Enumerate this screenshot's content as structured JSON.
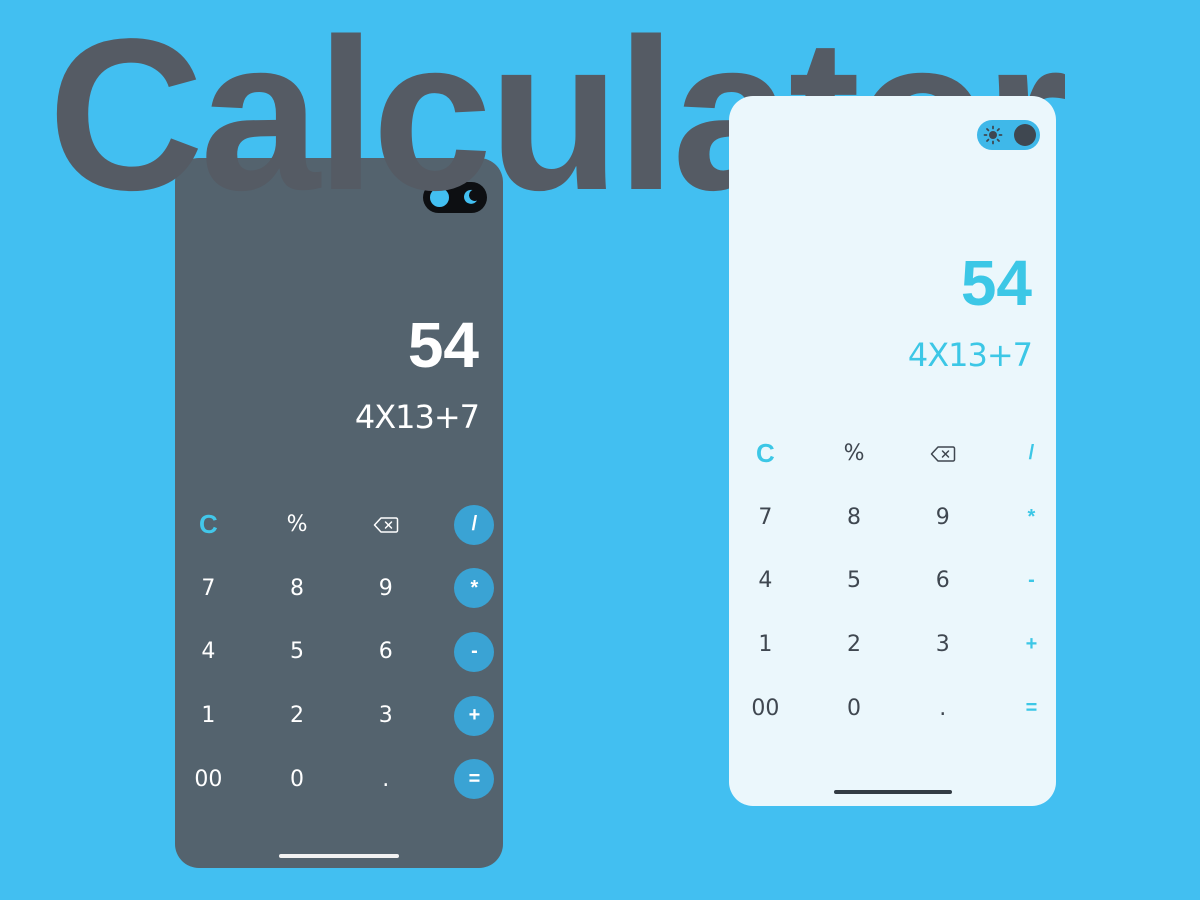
{
  "title": "Calculator",
  "dark_phone": {
    "result": "54",
    "expression": "4X13+7",
    "keys": [
      {
        "label": "C",
        "kind": "accent"
      },
      {
        "label": "%",
        "kind": "normal"
      },
      {
        "label": "",
        "kind": "backspace",
        "icon": "backspace-icon"
      },
      {
        "label": "/",
        "kind": "op"
      },
      {
        "label": "7",
        "kind": "normal"
      },
      {
        "label": "8",
        "kind": "normal"
      },
      {
        "label": "9",
        "kind": "normal"
      },
      {
        "label": "*",
        "kind": "op"
      },
      {
        "label": "4",
        "kind": "normal"
      },
      {
        "label": "5",
        "kind": "normal"
      },
      {
        "label": "6",
        "kind": "normal"
      },
      {
        "label": "-",
        "kind": "op"
      },
      {
        "label": "1",
        "kind": "normal"
      },
      {
        "label": "2",
        "kind": "normal"
      },
      {
        "label": "3",
        "kind": "normal"
      },
      {
        "label": "+",
        "kind": "op"
      },
      {
        "label": "00",
        "kind": "normal"
      },
      {
        "label": "0",
        "kind": "normal"
      },
      {
        "label": ".",
        "kind": "normal"
      },
      {
        "label": "=",
        "kind": "op"
      }
    ],
    "theme_toggle_icon": "moon-icon"
  },
  "light_phone": {
    "result": "54",
    "expression": "4X13+7",
    "keys": [
      {
        "label": "C",
        "kind": "accent"
      },
      {
        "label": "%",
        "kind": "normal"
      },
      {
        "label": "",
        "kind": "backspace",
        "icon": "backspace-icon"
      },
      {
        "label": "/",
        "kind": "op"
      },
      {
        "label": "7",
        "kind": "normal"
      },
      {
        "label": "8",
        "kind": "normal"
      },
      {
        "label": "9",
        "kind": "normal"
      },
      {
        "label": "*",
        "kind": "op"
      },
      {
        "label": "4",
        "kind": "normal"
      },
      {
        "label": "5",
        "kind": "normal"
      },
      {
        "label": "6",
        "kind": "normal"
      },
      {
        "label": "-",
        "kind": "op"
      },
      {
        "label": "1",
        "kind": "normal"
      },
      {
        "label": "2",
        "kind": "normal"
      },
      {
        "label": "3",
        "kind": "normal"
      },
      {
        "label": "+",
        "kind": "op"
      },
      {
        "label": "00",
        "kind": "normal"
      },
      {
        "label": "0",
        "kind": "normal"
      },
      {
        "label": ".",
        "kind": "normal"
      },
      {
        "label": "=",
        "kind": "op"
      }
    ],
    "theme_toggle_icon": "sun-icon"
  },
  "colors": {
    "background": "#42bff1",
    "dark_phone_bg": "#54636e",
    "light_phone_bg": "#ebf7fc",
    "accent": "#3cc7e6",
    "operator_circle": "#3aa3d4",
    "title": "#555b64"
  }
}
